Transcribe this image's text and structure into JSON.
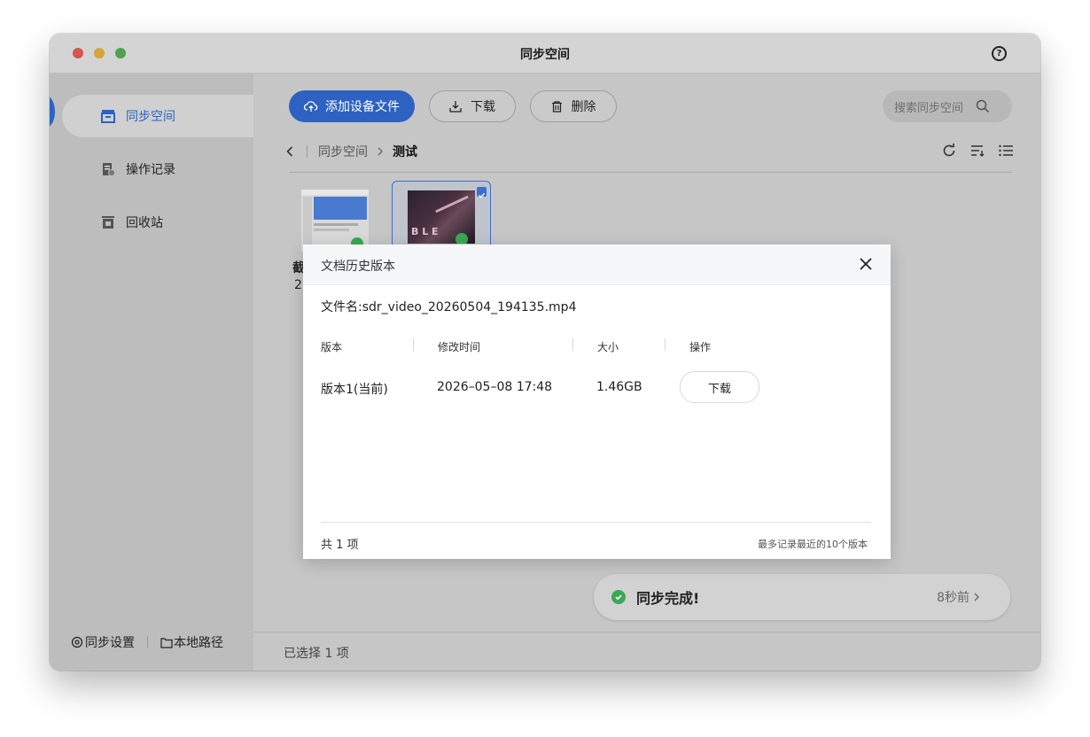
{
  "window": {
    "title": "同步空间"
  },
  "sidebar": {
    "items": [
      {
        "label": "同步空间",
        "icon": "sync-space-icon",
        "active": true
      },
      {
        "label": "操作记录",
        "icon": "operation-log-icon",
        "active": false
      },
      {
        "label": "回收站",
        "icon": "trash-icon",
        "active": false
      }
    ],
    "footer": {
      "settings_label": "同步设置",
      "local_path_label": "本地路径"
    }
  },
  "toolbar": {
    "add_label": "添加设备文件",
    "download_label": "下载",
    "delete_label": "删除",
    "search_placeholder": "搜索同步空间"
  },
  "breadcrumb": {
    "root": "同步空间",
    "current": "测试"
  },
  "files": [
    {
      "name_fragment": "截",
      "date_fragment": "2",
      "selected": false
    },
    {
      "name_fragment": "",
      "date_fragment": "",
      "selected": true
    }
  ],
  "status_bar": {
    "selection_text": "已选择 1 项"
  },
  "toast": {
    "message": "同步完成!",
    "time": "8秒前"
  },
  "modal": {
    "title": "文档历史版本",
    "filename_text": "文件名:sdr_video_20260504_194135.mp4",
    "columns": [
      "版本",
      "修改时间",
      "大小",
      "操作"
    ],
    "rows": [
      {
        "version": "版本1(当前)",
        "modified": "2026–05–08 17:48",
        "size": "1.46GB",
        "action_label": "下载"
      }
    ],
    "total_text": "共 1 项",
    "note_text": "最多记录最近的10个版本"
  },
  "colors": {
    "accent": "#2d62c2",
    "success": "#3aa856"
  }
}
